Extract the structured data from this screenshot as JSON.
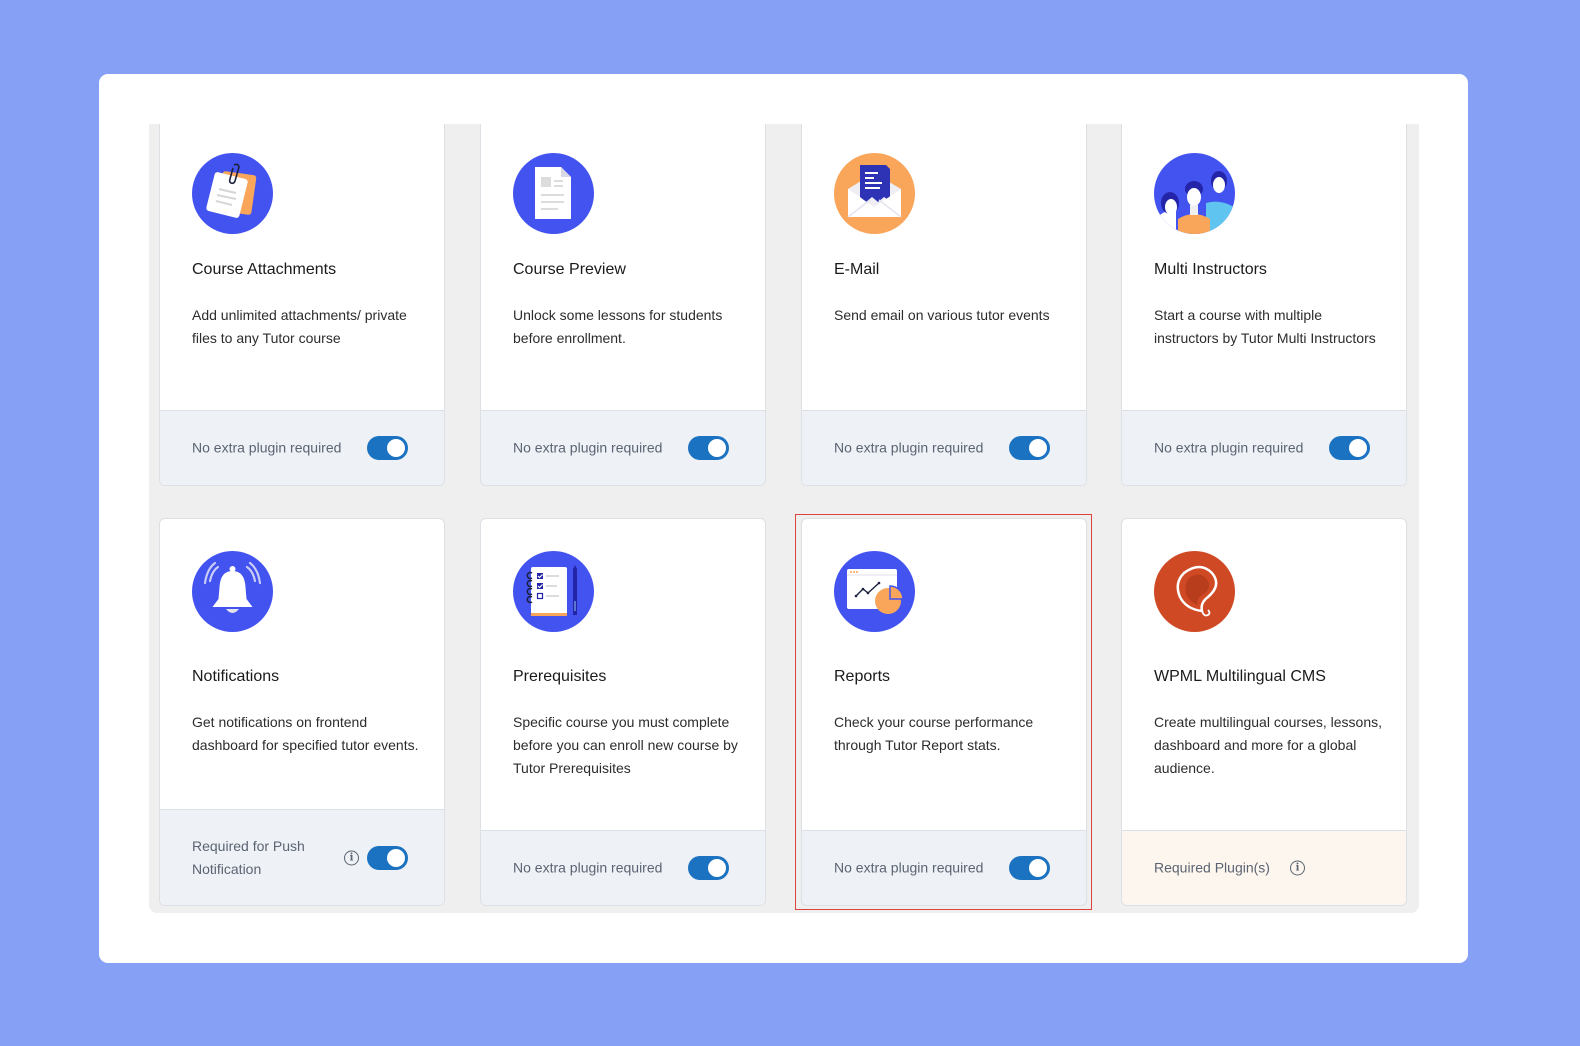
{
  "addons": [
    {
      "title": "Course Attachments",
      "description": "Add unlimited attachments/ private files to any Tutor course",
      "footer": "No extra plugin required",
      "enabled": true,
      "icon": "attachment-icon"
    },
    {
      "title": "Course Preview",
      "description": "Unlock some lessons for students before enrollment.",
      "footer": "No extra plugin required",
      "enabled": true,
      "icon": "document-preview-icon"
    },
    {
      "title": "E-Mail",
      "description": "Send email on various tutor events",
      "footer": "No extra plugin required",
      "enabled": true,
      "icon": "email-envelope-icon"
    },
    {
      "title": "Multi Instructors",
      "description": "Start a course with multiple instructors by Tutor Multi Instructors",
      "footer": "No extra plugin required",
      "enabled": true,
      "icon": "instructors-group-icon"
    },
    {
      "title": "Notifications",
      "description": "Get notifications on frontend dashboard for specified tutor events.",
      "footer": "Required for Push Notification",
      "enabled": true,
      "icon": "bell-icon",
      "info": true
    },
    {
      "title": "Prerequisites",
      "description": "Specific course you must complete before you can enroll new course by Tutor Prerequisites",
      "footer": "No extra plugin required",
      "enabled": true,
      "icon": "checklist-icon"
    },
    {
      "title": "Reports",
      "description": "Check your course performance through Tutor Report stats.",
      "footer": "No extra plugin required",
      "enabled": true,
      "icon": "report-chart-icon",
      "highlighted": true
    },
    {
      "title": "WPML Multilingual CMS",
      "description": "Create multilingual courses, lessons, dashboard and more for a global audience.",
      "footer": "Required Plugin(s)",
      "enabled": false,
      "icon": "wpml-logo-icon",
      "info": true
    }
  ],
  "colors": {
    "background": "#85a0f5",
    "toggle_on": "#1b72c0",
    "icon_blue": "#4353f0",
    "icon_orange": "#f9a55a",
    "wpml_red": "#cf4a24",
    "highlight": "#d9443c"
  }
}
